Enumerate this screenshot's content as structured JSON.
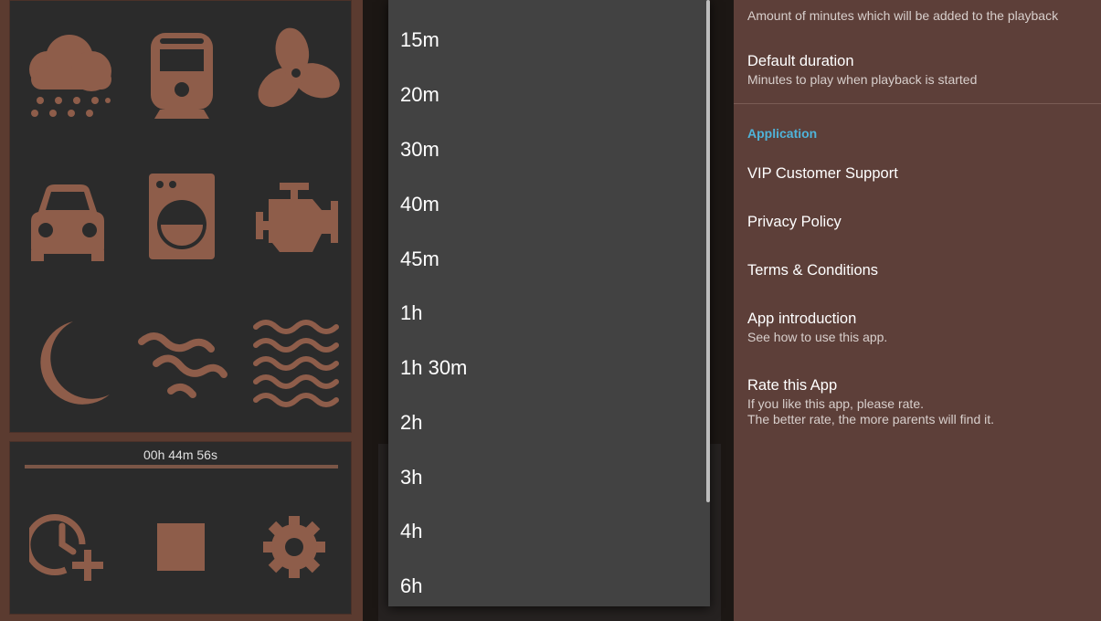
{
  "colors": {
    "icon": "#8e5d4a",
    "panel_dark": "#2b2b2b",
    "brown": "#5d3f39",
    "dropdown_bg": "#424242",
    "accent": "#4fb3d9"
  },
  "sounds": [
    {
      "icon": "rain-cloud-icon"
    },
    {
      "icon": "train-icon"
    },
    {
      "icon": "fan-icon"
    },
    {
      "icon": "car-icon"
    },
    {
      "icon": "washing-machine-icon"
    },
    {
      "icon": "engine-icon"
    },
    {
      "icon": "moon-icon"
    },
    {
      "icon": "wind-icon"
    },
    {
      "icon": "waves-icon"
    }
  ],
  "player": {
    "timer": "00h 44m 56s",
    "progress": 1.0,
    "buttons": [
      {
        "icon": "add-time-icon"
      },
      {
        "icon": "stop-icon"
      },
      {
        "icon": "gear-icon"
      }
    ]
  },
  "dropdown": {
    "items": [
      "15m",
      "20m",
      "30m",
      "40m",
      "45m",
      "1h",
      "1h 30m",
      "2h",
      "3h",
      "4h",
      "6h"
    ]
  },
  "settings": {
    "add_time": {
      "summary": "Amount of minutes which will be added to the playback"
    },
    "default_duration": {
      "title": "Default duration",
      "summary": "Minutes to play when playback is started"
    },
    "section_application": "Application",
    "vip_support": {
      "title": "VIP Customer Support"
    },
    "privacy": {
      "title": "Privacy Policy"
    },
    "terms": {
      "title": "Terms & Conditions"
    },
    "intro": {
      "title": "App introduction",
      "summary": "See how to use this app."
    },
    "rate": {
      "title": "Rate this App",
      "summary_line1": "If you like this app, please rate.",
      "summary_line2": "The better rate, the more parents will find it."
    }
  }
}
